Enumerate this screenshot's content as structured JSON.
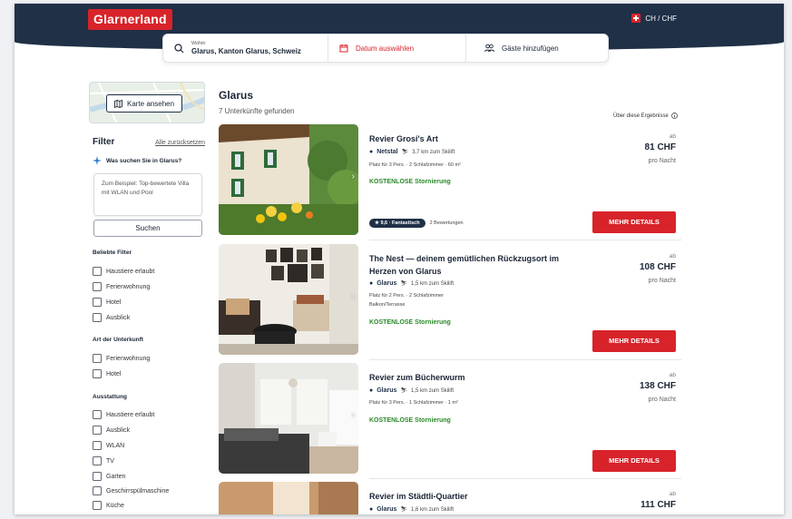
{
  "header": {
    "logo": "Glarnerland",
    "locale": "CH / CHF"
  },
  "search": {
    "where_label": "Wohin",
    "where_value": "Glarus, Kanton Glarus, Schweiz",
    "date_label": "Datum auswählen",
    "guests_label": "Gäste hinzufügen"
  },
  "map": {
    "button_label": "Karte ansehen"
  },
  "filters": {
    "title": "Filter",
    "reset": "Alle zurücksetzen",
    "ai_question": "Was suchen Sie in Glarus?",
    "ai_placeholder": "Zum Beispiel: Top-bewertete Villa mit WLAN und Pool",
    "ai_button": "Suchen",
    "sections": [
      {
        "title": "Beliebte Filter",
        "items": [
          "Haustiere erlaubt",
          "Ferienwohnung",
          "Hotel",
          "Ausblick"
        ]
      },
      {
        "title": "Art der Unterkunft",
        "items": [
          "Ferienwohnung",
          "Hotel"
        ]
      },
      {
        "title": "Ausstattung",
        "items": [
          "Haustiere erlaubt",
          "Ausblick",
          "WLAN",
          "TV",
          "Garten",
          "Geschirrspülmaschine",
          "Küche"
        ]
      }
    ]
  },
  "results": {
    "title": "Glarus",
    "count": "7 Unterkünfte gefunden",
    "about": "Über diese Ergebnisse",
    "listings": [
      {
        "name": "Revier Grosi's Art",
        "town": "Netstal",
        "distance": "3,7 km zum Skilift",
        "meta": "Platz für 3 Pers. · 2 Schlafzimmer · 60 m²",
        "extra": "",
        "free_cancel": "KOSTENLOSE Stornierung",
        "price_prefix": "ab",
        "price": "81 CHF",
        "per_night": "pro Nacht",
        "rating": "★ 9,6 · Fantastisch",
        "reviews": "2 Bewertungen",
        "cta": "MEHR DETAILS"
      },
      {
        "name": "The Nest — deinem gemütlichen Rückzugsort im Herzen von Glarus",
        "town": "Glarus",
        "distance": "1,5 km zum Skilift",
        "meta": "Platz für 2 Pers. · 2 Schlafzimmer",
        "extra": "Balkon/Terrasse",
        "free_cancel": "KOSTENLOSE Stornierung",
        "price_prefix": "ab",
        "price": "108 CHF",
        "per_night": "pro Nacht",
        "cta": "MEHR DETAILS"
      },
      {
        "name": "Revier zum Bücherwurm",
        "town": "Glarus",
        "distance": "1,5 km zum Skilift",
        "meta": "Platz für 3 Pers. · 1 Schlafzimmer · 1 m²",
        "extra": "",
        "free_cancel": "KOSTENLOSE Stornierung",
        "price_prefix": "ab",
        "price": "138 CHF",
        "per_night": "pro Nacht",
        "cta": "MEHR DETAILS"
      },
      {
        "name": "Revier im Städtli-Quartier",
        "town": "Glarus",
        "distance": "1,6 km zum Skilift",
        "price_prefix": "ab",
        "price": "111 CHF"
      }
    ]
  },
  "colors": {
    "navy": "#1f3047",
    "red": "#d8232a",
    "green": "#2b8a2b"
  }
}
